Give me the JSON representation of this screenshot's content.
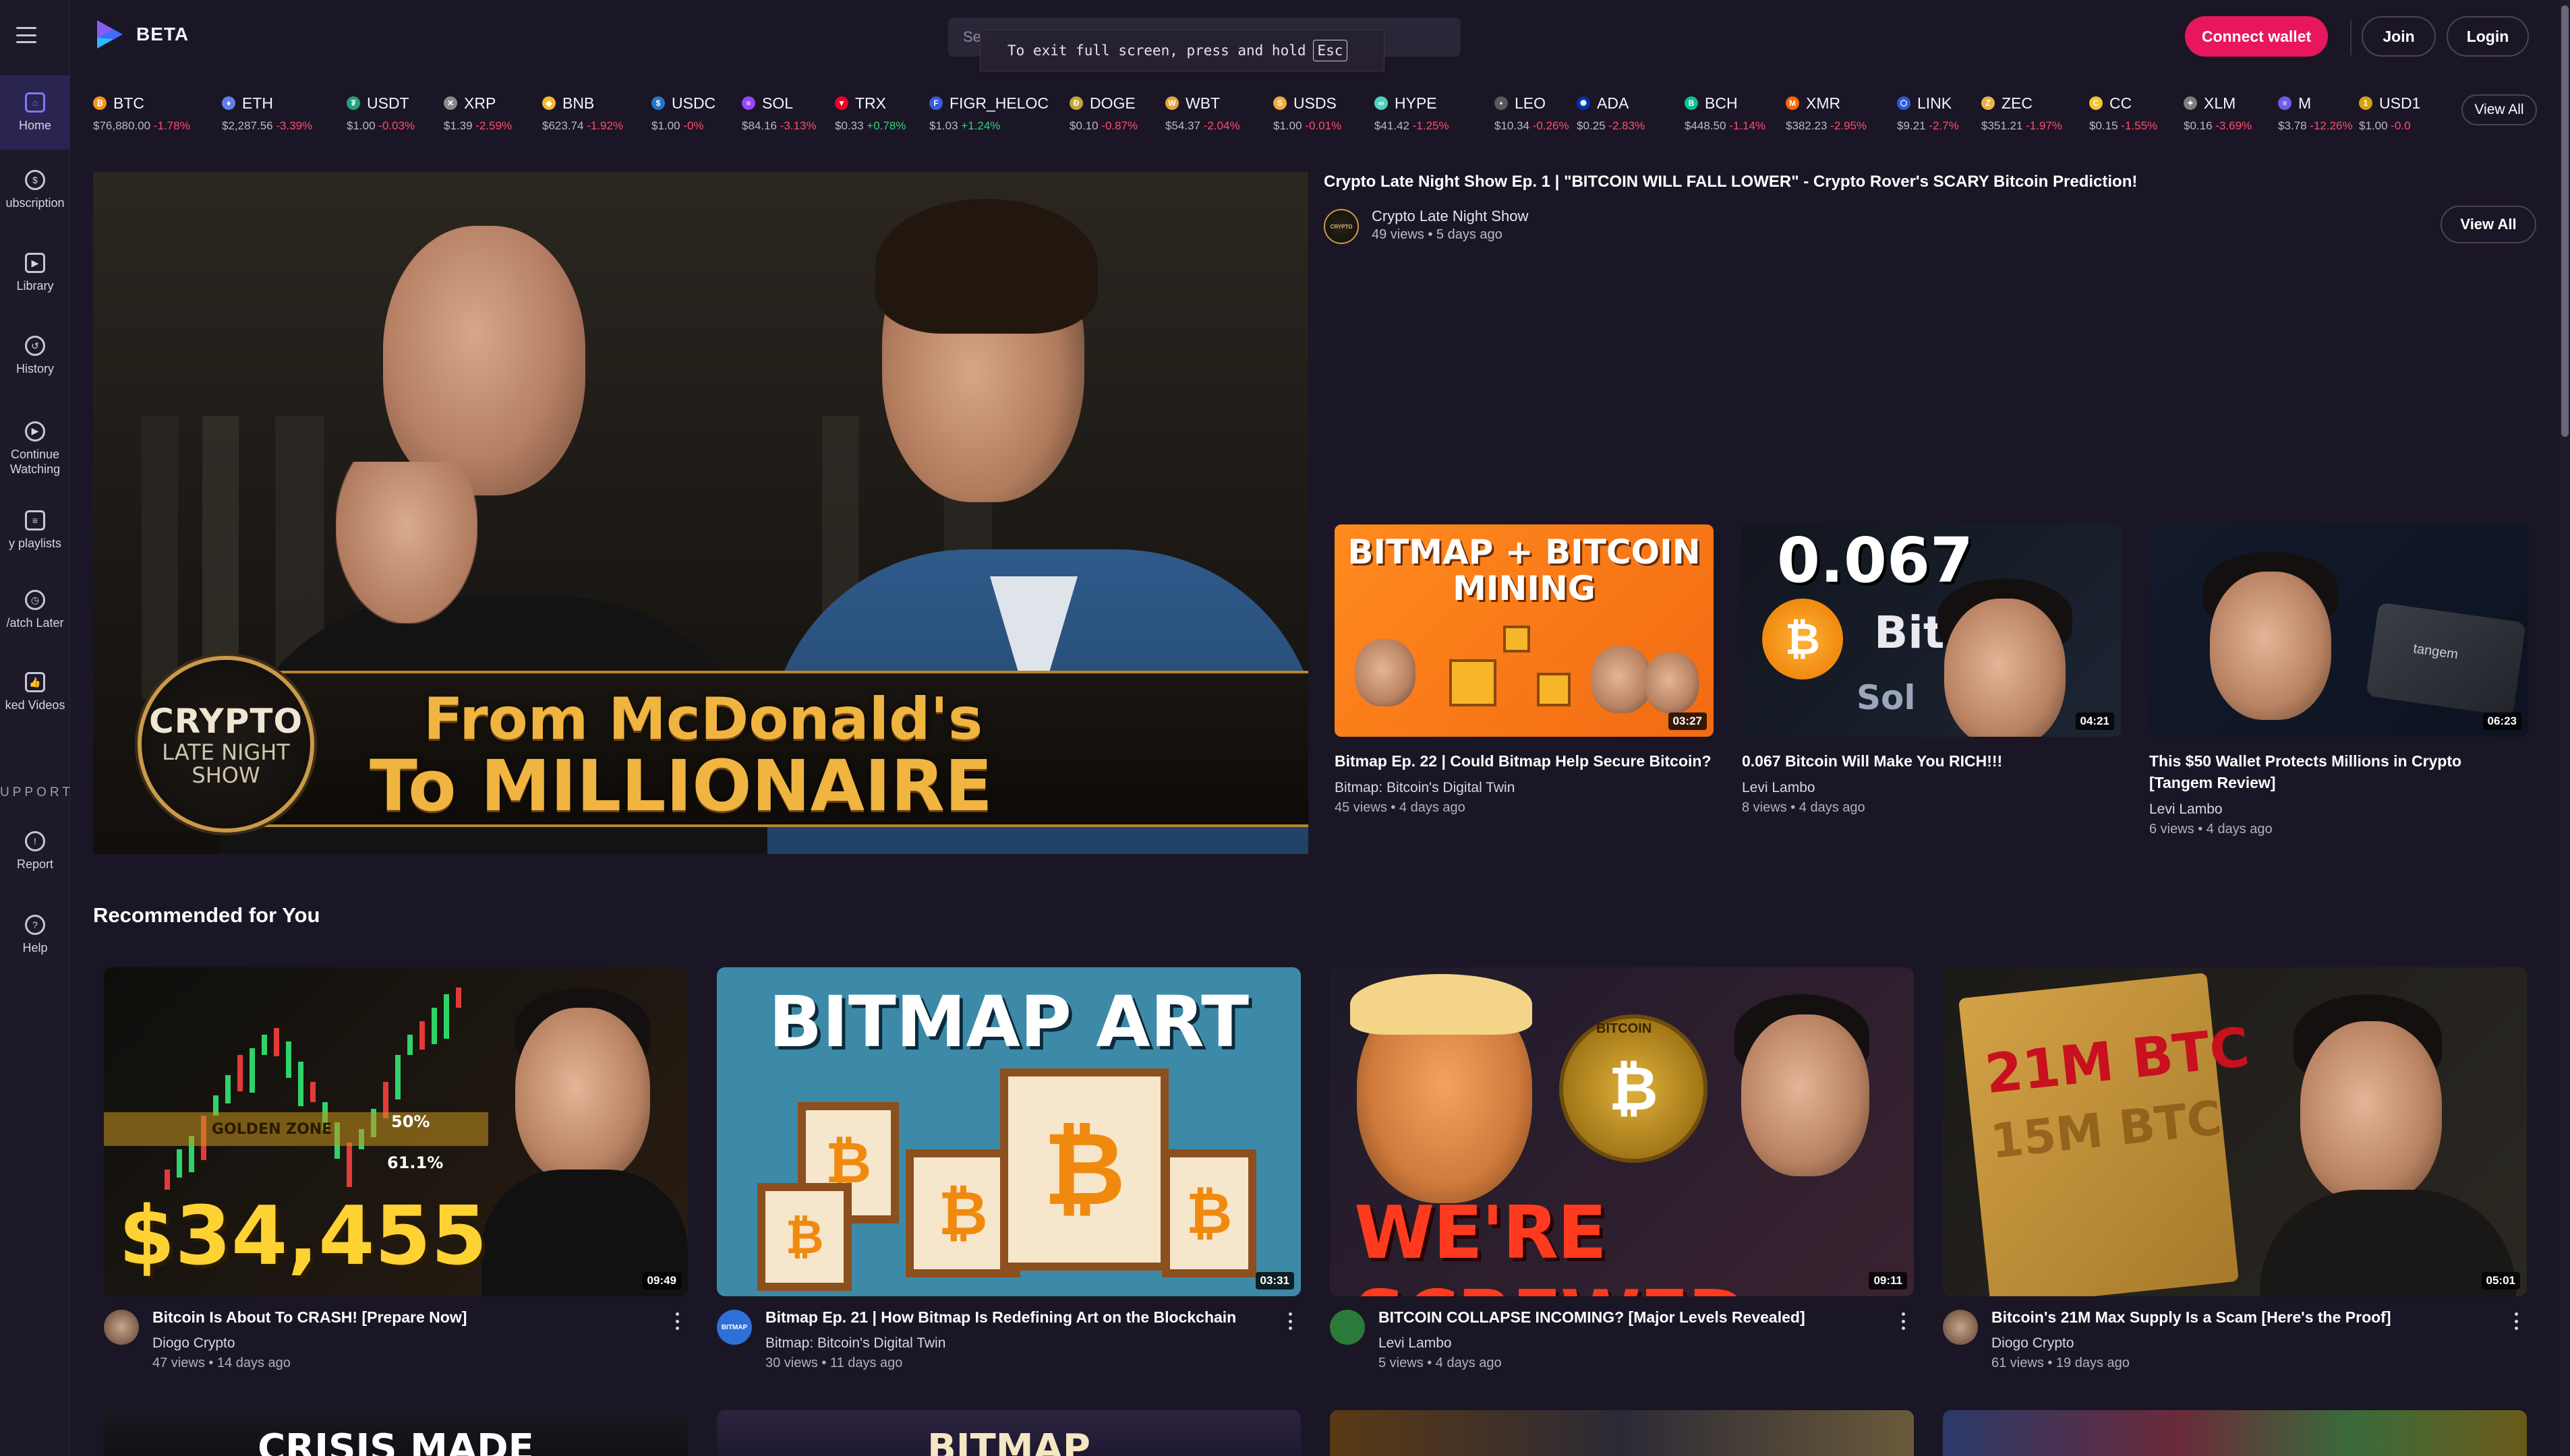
{
  "app": {
    "logo_text": "BETA",
    "brand_color": "#e8175d",
    "accent_color": "#7c7af5"
  },
  "topbar": {
    "search_placeholder": "Search...",
    "fullscreen_toast_text": "To exit full screen, press and hold",
    "fullscreen_toast_key": "Esc",
    "connect_wallet_label": "Connect wallet",
    "join_label": "Join",
    "login_label": "Login"
  },
  "sidebar": {
    "items": [
      {
        "label": "Home",
        "icon": "home-icon"
      },
      {
        "label": "ubscription",
        "icon": "subscription-icon"
      },
      {
        "label": "Library",
        "icon": "library-icon"
      },
      {
        "label": "History",
        "icon": "history-icon"
      },
      {
        "label": "Continue Watching",
        "icon": "play-circle-icon"
      },
      {
        "label": "y playlists",
        "icon": "playlist-icon"
      },
      {
        "label": "/atch Later",
        "icon": "clock-icon"
      },
      {
        "label": "ked Videos",
        "icon": "thumbs-up-icon"
      },
      {
        "label": "Report",
        "icon": "alert-icon"
      },
      {
        "label": "Help",
        "icon": "help-icon"
      }
    ],
    "section_label": "UPPORT"
  },
  "ticker": {
    "view_all_label": "View All",
    "coins": [
      {
        "symbol": "BTC",
        "price": "$76,880.00",
        "change": "-1.78%",
        "dir": "neg",
        "color": "#f7931a",
        "glyph": "₿"
      },
      {
        "symbol": "ETH",
        "price": "$2,287.56",
        "change": "-3.39%",
        "dir": "neg",
        "color": "#627eea",
        "glyph": "♦"
      },
      {
        "symbol": "USDT",
        "price": "$1.00",
        "change": "-0.03%",
        "dir": "neg",
        "color": "#26a17b",
        "glyph": "₮"
      },
      {
        "symbol": "XRP",
        "price": "$1.39",
        "change": "-2.59%",
        "dir": "neg",
        "color": "#8a8a8a",
        "glyph": "✕"
      },
      {
        "symbol": "BNB",
        "price": "$623.74",
        "change": "-1.92%",
        "dir": "neg",
        "color": "#f3ba2f",
        "glyph": "◆"
      },
      {
        "symbol": "USDC",
        "price": "$1.00",
        "change": "-0%",
        "dir": "neg",
        "color": "#2775ca",
        "glyph": "$"
      },
      {
        "symbol": "SOL",
        "price": "$84.16",
        "change": "-3.13%",
        "dir": "neg",
        "color": "#9945ff",
        "glyph": "≡"
      },
      {
        "symbol": "TRX",
        "price": "$0.33",
        "change": "+0.78%",
        "dir": "pos",
        "color": "#ef0027",
        "glyph": "▼"
      },
      {
        "symbol": "FIGR_HELOC",
        "price": "$1.03",
        "change": "+1.24%",
        "dir": "pos",
        "color": "#3b5bdb",
        "glyph": "F"
      },
      {
        "symbol": "DOGE",
        "price": "$0.10",
        "change": "-0.87%",
        "dir": "neg",
        "color": "#c2a633",
        "glyph": "Ð"
      },
      {
        "symbol": "WBT",
        "price": "$54.37",
        "change": "-2.04%",
        "dir": "neg",
        "color": "#e8a33d",
        "glyph": "W"
      },
      {
        "symbol": "USDS",
        "price": "$1.00",
        "change": "-0.01%",
        "dir": "neg",
        "color": "#f5ac37",
        "glyph": "S"
      },
      {
        "symbol": "HYPE",
        "price": "$41.42",
        "change": "-1.25%",
        "dir": "neg",
        "color": "#50d2c1",
        "glyph": "∞"
      },
      {
        "symbol": "LEO",
        "price": "$10.34",
        "change": "-0.26%",
        "dir": "neg",
        "color": "#5a5a5a",
        "glyph": "•"
      },
      {
        "symbol": "ADA",
        "price": "$0.25",
        "change": "-2.83%",
        "dir": "neg",
        "color": "#0033ad",
        "glyph": "✺"
      },
      {
        "symbol": "BCH",
        "price": "$448.50",
        "change": "-1.14%",
        "dir": "neg",
        "color": "#0ac18e",
        "glyph": "B"
      },
      {
        "symbol": "XMR",
        "price": "$382.23",
        "change": "-2.95%",
        "dir": "neg",
        "color": "#ff6600",
        "glyph": "M"
      },
      {
        "symbol": "LINK",
        "price": "$9.21",
        "change": "-2.7%",
        "dir": "neg",
        "color": "#2a5ada",
        "glyph": "⬡"
      },
      {
        "symbol": "ZEC",
        "price": "$351.21",
        "change": "-1.97%",
        "dir": "neg",
        "color": "#ecb244",
        "glyph": "Z"
      },
      {
        "symbol": "CC",
        "price": "$0.15",
        "change": "-1.55%",
        "dir": "neg",
        "color": "#f4c430",
        "glyph": "C"
      },
      {
        "symbol": "XLM",
        "price": "$0.16",
        "change": "-3.69%",
        "dir": "neg",
        "color": "#7d7d7d",
        "glyph": "✦"
      },
      {
        "symbol": "M",
        "price": "$3.78",
        "change": "-12.26%",
        "dir": "neg",
        "color": "#6c5ce7",
        "glyph": "≡"
      },
      {
        "symbol": "USD1",
        "price": "$1.00",
        "change": "-0.0",
        "dir": "neg",
        "color": "#d4a017",
        "glyph": "1"
      }
    ]
  },
  "featured": {
    "hero_line1": "From McDonald's",
    "hero_line2": "To MILLIONAIRE",
    "hero_badge_line1": "CRYPTO",
    "hero_badge_line2": "LATE NIGHT",
    "hero_badge_line3": "SHOW",
    "title": "Crypto Late Night Show Ep. 1 | \"BITCOIN WILL FALL LOWER\" - Crypto Rover's SCARY Bitcoin Prediction!",
    "channel": "Crypto Late Night Show",
    "meta": "49 views • 5 days ago",
    "avatar_text": "CRYPTO",
    "view_all_label": "View All"
  },
  "side_videos": [
    {
      "title": "Bitmap Ep. 22 | Could Bitmap Help Secure Bitcoin?",
      "channel": "Bitmap: Bitcoin's Digital Twin",
      "meta": "45 views • 4 days ago",
      "duration": "03:27",
      "thumb_text": "BITMAP + BITCOIN MINING"
    },
    {
      "title": "0.067 Bitcoin Will Make You RICH!!!",
      "channel": "Levi Lambo",
      "meta": "8 views • 4 days ago",
      "duration": "04:21",
      "thumb_text": "0.067",
      "thumb_text2": "Bitcoi",
      "thumb_text3": "Sol"
    },
    {
      "title": "This $50 Wallet Protects Millions in Crypto [Tangem Review]",
      "channel": "Levi Lambo",
      "meta": "6 views • 4 days ago",
      "duration": "06:23",
      "thumb_text": "tangem"
    }
  ],
  "recommended": {
    "heading": "Recommended for You",
    "videos": [
      {
        "title": "Bitcoin Is About To CRASH! [Prepare Now]",
        "channel": "Diogo Crypto",
        "meta": "47 views • 14 days ago",
        "duration": "09:49",
        "thumb_text": "$34,455",
        "zone_text": "GOLDEN ZONE",
        "pct1": "50%",
        "pct2": "61.1%"
      },
      {
        "title": "Bitmap Ep. 21 | How Bitmap Is Redefining Art on the Blockchain",
        "channel": "Bitmap: Bitcoin's Digital Twin",
        "meta": "30 views • 11 days ago",
        "duration": "03:31",
        "thumb_text": "BITMAP ART",
        "avatar_text": "BITMAP"
      },
      {
        "title": "BITCOIN COLLAPSE INCOMING? [Major Levels Revealed]",
        "channel": "Levi Lambo",
        "meta": "5 views • 4 days ago",
        "duration": "09:11",
        "thumb_text": "WE'RE SCREWED",
        "coin_text": "BITCOIN"
      },
      {
        "title": "Bitcoin's 21M Max Supply Is a Scam [Here's the Proof]",
        "channel": "Diogo Crypto",
        "meta": "61 views • 19 days ago",
        "duration": "05:01",
        "thumb_text": "21M BTC",
        "thumb_text2": "15M BTC"
      }
    ],
    "next_row": [
      "CRISIS MADE",
      "BITMAP",
      "",
      ""
    ]
  }
}
